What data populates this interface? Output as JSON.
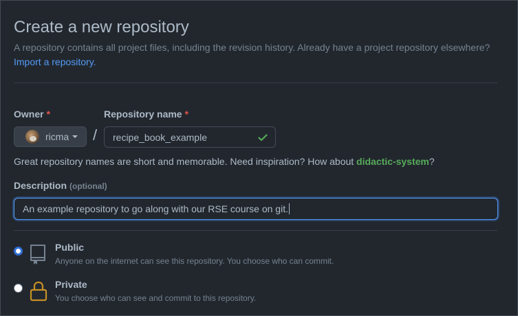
{
  "header": {
    "title": "Create a new repository",
    "subtitle": "A repository contains all project files, including the revision history. Already have a project repository elsewhere?",
    "import_link": "Import a repository."
  },
  "owner": {
    "label": "Owner",
    "required_mark": "*",
    "selected": "ricma"
  },
  "repo_name": {
    "label": "Repository name",
    "required_mark": "*",
    "value": "recipe_book_example",
    "separator": "/"
  },
  "hint": {
    "text": "Great repository names are short and memorable. Need inspiration? How about ",
    "suggestion": "didactic-system",
    "suffix": "?"
  },
  "description": {
    "label": "Description",
    "optional": "(optional)",
    "value": "An example repository to go along with our RSE course on git."
  },
  "visibility": {
    "options": [
      {
        "title": "Public",
        "desc": "Anyone on the internet can see this repository. You choose who can commit.",
        "selected": true,
        "icon": "repo-icon"
      },
      {
        "title": "Private",
        "desc": "You choose who can see and commit to this repository.",
        "selected": false,
        "icon": "lock-icon"
      }
    ]
  },
  "colors": {
    "background": "#22272e",
    "accent": "#539bf5",
    "success": "#57ab5a",
    "danger": "#e5534b",
    "warning": "#c69026"
  }
}
